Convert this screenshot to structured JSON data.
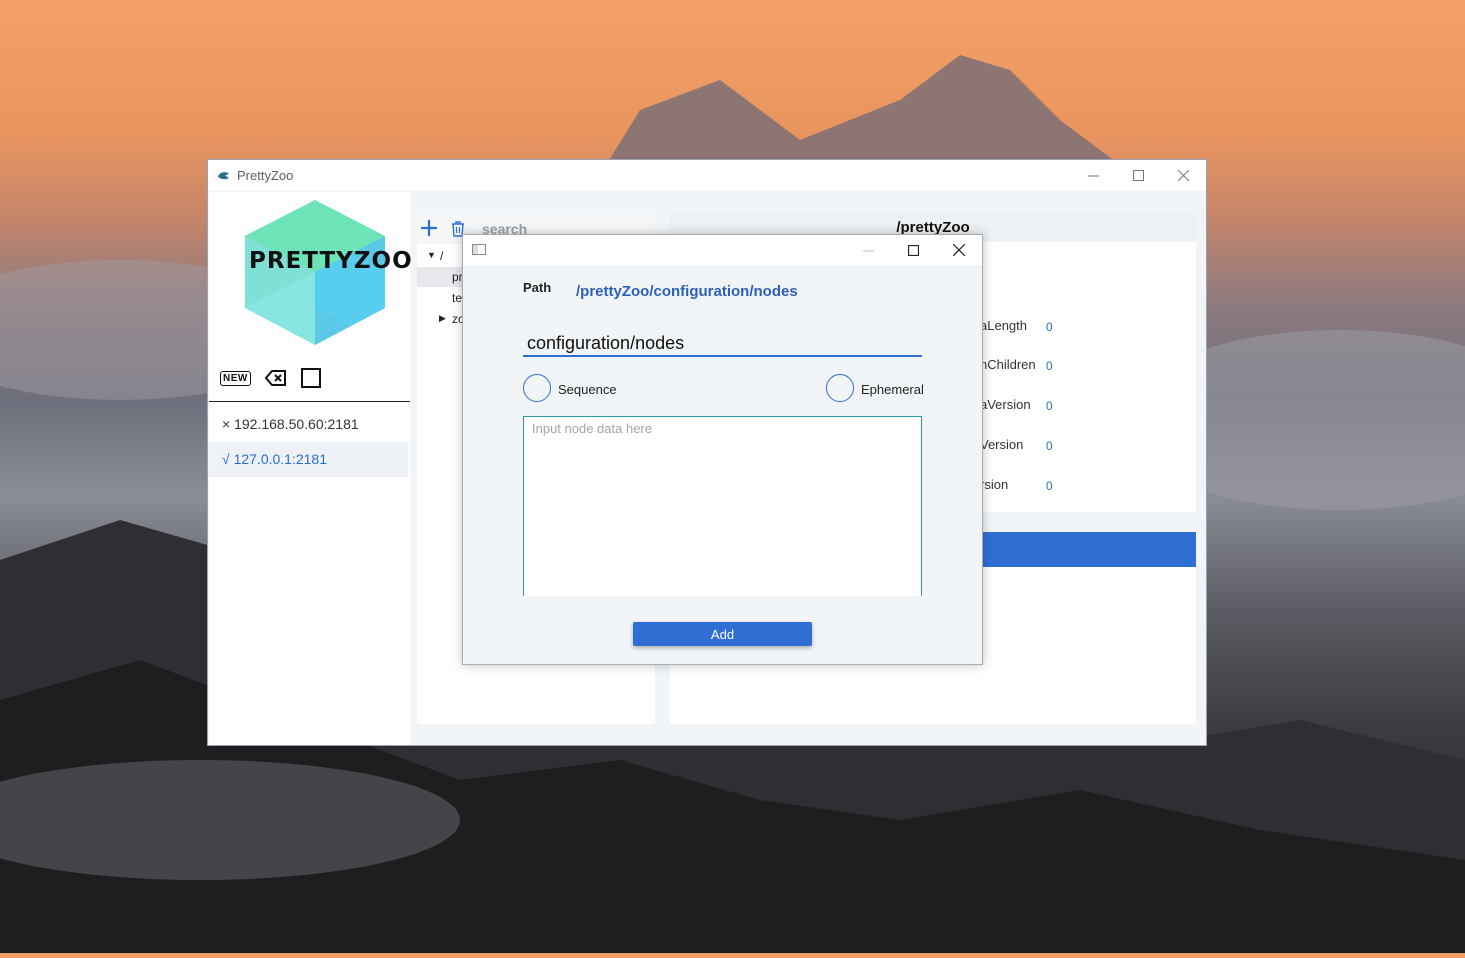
{
  "app": {
    "title": "PrettyZoo",
    "logo_text": "PRETTYZOO"
  },
  "toolbar": {
    "new_label": "NEW"
  },
  "servers": [
    {
      "status": "×",
      "address": "192.168.50.60:2181"
    },
    {
      "status": "√",
      "address": "127.0.0.1:2181"
    }
  ],
  "tree": {
    "search_placeholder": "search",
    "root": "/",
    "items": [
      "pr",
      "te",
      "zo"
    ]
  },
  "detail": {
    "path": "/prettyZoo",
    "stats": [
      {
        "label": "aLength",
        "value": "0"
      },
      {
        "label": "nChildren",
        "value": "0"
      },
      {
        "label": "aVersion",
        "value": "0"
      },
      {
        "label": "Version",
        "value": "0"
      },
      {
        "label": "rsion",
        "value": "0"
      }
    ]
  },
  "dialog": {
    "path_label": "Path",
    "path_value": "/prettyZoo/configuration/nodes",
    "node_input_value": "configuration/nodes",
    "sequence_label": "Sequence",
    "ephemeral_label": "Ephemeral",
    "data_placeholder": "Input node data here",
    "add_label": "Add"
  },
  "colors": {
    "accent": "#2f6fd4",
    "link": "#2d5fb8",
    "teal": "#2d9aa5"
  },
  "icons": {
    "app": "prettyzoo-bird-icon",
    "new": "new-badge-icon",
    "clear": "backspace-icon",
    "square": "square-icon",
    "add": "plus-icon",
    "delete": "trash-icon"
  }
}
